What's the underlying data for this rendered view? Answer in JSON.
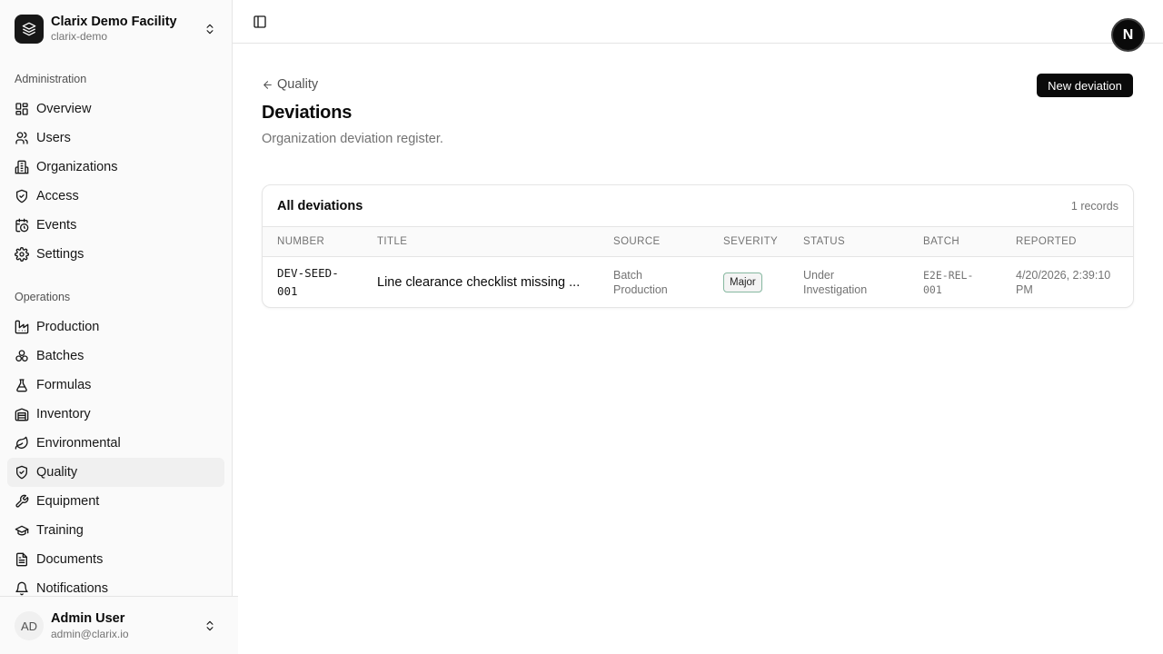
{
  "org": {
    "name": "Clarix Demo Facility",
    "slug": "clarix-demo"
  },
  "nav": {
    "administration_label": "Administration",
    "administration": [
      {
        "label": "Overview",
        "icon": "grid-icon"
      },
      {
        "label": "Users",
        "icon": "users-icon"
      },
      {
        "label": "Organizations",
        "icon": "building-icon"
      },
      {
        "label": "Access",
        "icon": "shield-check-icon"
      },
      {
        "label": "Events",
        "icon": "calendar-clock-icon"
      },
      {
        "label": "Settings",
        "icon": "gear-icon"
      }
    ],
    "operations_label": "Operations",
    "operations": [
      {
        "label": "Production",
        "icon": "factory-icon"
      },
      {
        "label": "Batches",
        "icon": "boxes-icon"
      },
      {
        "label": "Formulas",
        "icon": "flask-icon"
      },
      {
        "label": "Inventory",
        "icon": "warehouse-icon"
      },
      {
        "label": "Environmental",
        "icon": "leaf-icon"
      },
      {
        "label": "Quality",
        "icon": "shield-check-icon",
        "active": true
      },
      {
        "label": "Equipment",
        "icon": "wrench-icon"
      },
      {
        "label": "Training",
        "icon": "graduation-cap-icon"
      },
      {
        "label": "Documents",
        "icon": "document-icon"
      },
      {
        "label": "Notifications",
        "icon": "bell-icon"
      }
    ]
  },
  "user": {
    "initials": "AD",
    "name": "Admin User",
    "email": "admin@clarix.io"
  },
  "badge_letter": "N",
  "page": {
    "back_label": "Quality",
    "title": "Deviations",
    "subtitle": "Organization deviation register.",
    "new_button": "New deviation"
  },
  "table": {
    "title": "All deviations",
    "count": "1 records",
    "columns": [
      "NUMBER",
      "TITLE",
      "SOURCE",
      "SEVERITY",
      "STATUS",
      "BATCH",
      "REPORTED"
    ],
    "rows": [
      {
        "number_line1": "DEV-SEED-",
        "number_line2": "001",
        "title": "Line clearance checklist missing ...",
        "source_line1": "Batch",
        "source_line2": "Production",
        "severity": "Major",
        "status_line1": "Under",
        "status_line2": "Investigation",
        "batch_line1": "E2E-REL-",
        "batch_line2": "001",
        "reported_line1": "4/20/2026, 2:39:10",
        "reported_line2": "PM"
      }
    ]
  },
  "colors": {
    "primary": "#0a0a0a",
    "sidebar_bg": "#fafafa",
    "border": "#e5e5e5",
    "muted_text": "#737373",
    "severity_border": "#86b8a0"
  }
}
